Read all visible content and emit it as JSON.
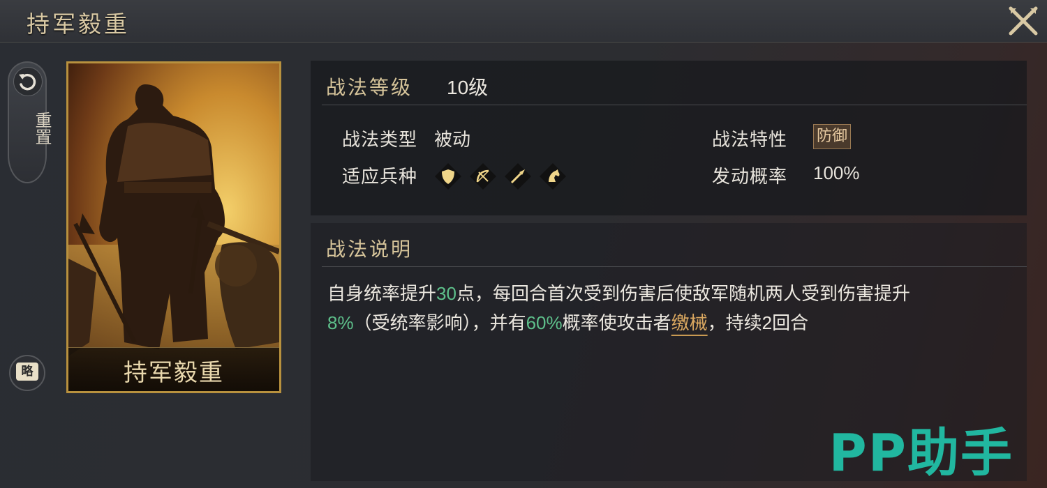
{
  "window": {
    "title": "持军毅重"
  },
  "left_rail": {
    "reset_label": "重置",
    "brief_label": "略"
  },
  "card": {
    "name": "持军毅重"
  },
  "info": {
    "level_label": "战法等级",
    "level_value": "10级",
    "type_label": "战法类型",
    "type_value": "被动",
    "trait_label": "战法特性",
    "trait_badge": "防御",
    "troops_label": "适应兵种",
    "troops": [
      "shield-icon",
      "bow-icon",
      "spear-icon",
      "horse-icon"
    ],
    "chance_label": "发动概率",
    "chance_value": "100%"
  },
  "description": {
    "heading": "战法说明",
    "part1": "自身统率提升",
    "v1": "30",
    "part2": "点，每回合首次受到伤害后使敌军随机两人受到伤害提升",
    "v2": "8%",
    "part3": "（受统率影响），并有",
    "v3": "60%",
    "part4": "概率使攻击者",
    "link": "缴械",
    "part5": "，持续2回合"
  },
  "watermark": "PP助手",
  "colors": {
    "highlight": "#5ec08b",
    "gold": "#d6c49a",
    "link": "#dba860",
    "watermark": "#21b7a0"
  }
}
